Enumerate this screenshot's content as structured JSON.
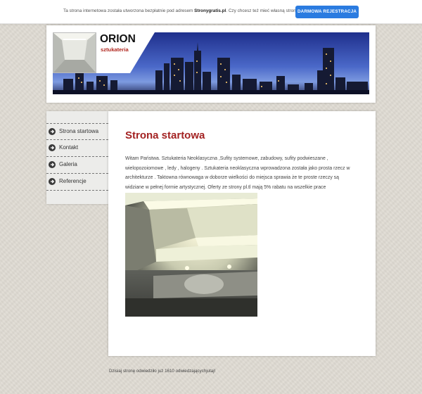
{
  "notice_bar": {
    "text_before": "Ta strona internetowa została utworzona bezpłatnie pod adresem ",
    "site_name": "Stronygratis.pl",
    "text_after": ". Czy chcesz też mieć własną stronę?",
    "register_button": "DARMOWA REJESTRACJA",
    "button_color": "#2a7be0"
  },
  "header": {
    "title": "ORION",
    "subtitle": "sztukateria"
  },
  "sidebar": {
    "items": [
      {
        "label": "Strona startowa",
        "icon": "arrow-circle-icon"
      },
      {
        "label": "Kontakt",
        "icon": "arrow-circle-icon"
      },
      {
        "label": "Galeria",
        "icon": "arrow-circle-icon"
      },
      {
        "label": "Referencje",
        "icon": "arrow-circle-icon"
      }
    ]
  },
  "main": {
    "title": "Strona startowa",
    "intro_lines": [
      "Witam Państwa. Sztukateria Neoklasyczna ,Sufity systemowe, zabudowy, sufity podwieszane ,",
      "wielopozoiomowe , ledy , halogeny .  Sztukateria neoklasyczna wprowadzona została jako prosta rzecz w",
      "architekturze . Taktowna równowaga w doborze wielkości do miejsca sprawia że te proste rzeczy są",
      "widziane w pełnej formie artystycznej. Oferty ze strony pl.tl mają 5% rabatu na wszelkie prace"
    ],
    "title_color": "#a32222"
  },
  "footer": {
    "visits_text": "Dzisiaj stronę odwiedziło już 1610 odwiedzającychjutaj!"
  }
}
